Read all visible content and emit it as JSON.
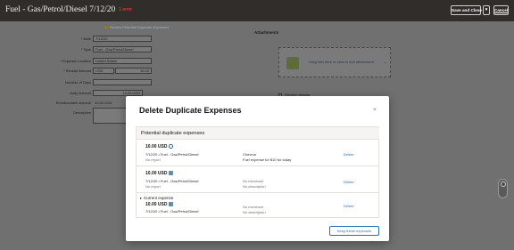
{
  "window": {
    "title": "Fuel - Gas/Petrol/Diesel 7/12/20",
    "error_flag": "1 error",
    "save_close_label": "Save and Close",
    "dropdown_glyph": "▾",
    "cancel_label": "Cancel"
  },
  "form": {
    "duplicate_link": "Review Potential Duplicate Expenses",
    "fields": [
      {
        "label": "* Date",
        "value": "7/12/20"
      },
      {
        "label": "* Type",
        "value": "Fuel - Gas/Petrol/Diesel"
      },
      {
        "label": "* Expense Location",
        "value": "United States"
      },
      {
        "label": "* Receipt Amount",
        "currency": "USD",
        "value": "10.00"
      },
      {
        "label": "Number of Days",
        "value": ""
      },
      {
        "label": "Daily Amount",
        "value": "10.00 USD"
      },
      {
        "label": "Reimbursable Amount",
        "value": "10.00 USD"
      },
      {
        "label": "Description",
        "value": ""
      }
    ],
    "attachments_label": "Attachments",
    "drop_text": "Drag files here or click to add attachment",
    "receipt_missing_label": "Receipt missing"
  },
  "modal": {
    "title": "Delete Duplicate Expenses",
    "close_glyph": "×",
    "section_title": "Potential duplicate expenses",
    "rows": [
      {
        "amount": "10.00 USD",
        "badge": "info-icon",
        "date_type": "7/12/20 • Fuel - Gas/Petrol/Diesel",
        "report": "No report",
        "merchant": "Chevron",
        "description": "Fuel expense for $10 for today",
        "delete_label": "Delete"
      },
      {
        "amount": "10.00 USD",
        "badge": "receipt-icon",
        "date_type": "7/12/20 • Fuel - Gas/Petrol/Diesel",
        "report": "No report",
        "merchant": "No merchant",
        "description": "No description",
        "delete_label": "Delete"
      }
    ],
    "current": {
      "heading": "Current expense",
      "amount": "10.00 USD",
      "badge": "receipt-icon",
      "date_type": "7/12/20 • Fuel - Gas/Petrol/Diesel",
      "merchant": "No merchant",
      "description": "No description",
      "delete_label": "Delete"
    },
    "keep_label": "Keep these expenses"
  },
  "colors": {
    "topbar": "#312d2a",
    "overlay_page": "#707070",
    "link_blue": "#2c6fb3",
    "error_red": "#e8503a"
  }
}
